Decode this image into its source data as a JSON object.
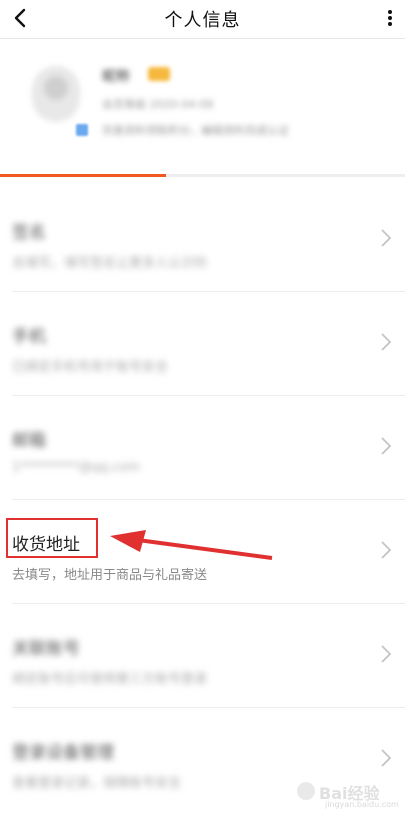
{
  "header": {
    "title": "个人信息",
    "back_icon": "chevron-left-icon",
    "more_icon": "more-vertical-icon"
  },
  "profile": {
    "username": "昵称",
    "line1": "会员等级 2020-04-08",
    "line2": "完善资料领取积分，编辑资料完成认证"
  },
  "progress": {
    "fraction": 0.41
  },
  "rows": [
    {
      "title": "签名",
      "desc": "去填写，填写签名让更多人认识你",
      "blurred": true
    },
    {
      "title": "手机",
      "desc": "已绑定手机号用于账号安全",
      "blurred": true
    },
    {
      "title": "邮箱",
      "desc": "1*********@qq.com",
      "blurred": true
    },
    {
      "title": "收货地址",
      "desc": "去填写，地址用于商品与礼品寄送",
      "blurred": false
    },
    {
      "title": "关联账号",
      "desc": "绑定账号后可使用第三方账号登录",
      "blurred": true
    },
    {
      "title": "登录设备管理",
      "desc": "查看登录记录，保障账号安全",
      "blurred": true
    }
  ],
  "colors": {
    "accent": "#f05a22",
    "highlight": "#e03030"
  },
  "watermark": {
    "main": "Bai经验",
    "sub": "jingyan.baidu.com"
  }
}
